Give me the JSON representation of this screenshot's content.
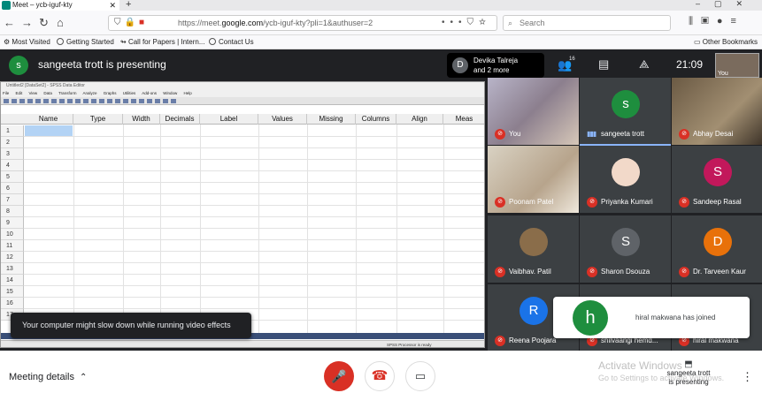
{
  "browser": {
    "tab_title": "Meet – ycb-iguf-kty",
    "url_prefix": "https://meet.",
    "url_domain": "google.com",
    "url_rest": "/ycb-iguf-kty?pli=1&authuser=2",
    "search_placeholder": "Search",
    "bookmarks": [
      "Most Visited",
      "Getting Started",
      "Call for Papers | Intern...",
      "Contact Us"
    ],
    "other_bookmarks": "Other Bookmarks"
  },
  "meet": {
    "presenter_initial": "s",
    "presenting_title": "sangeeta trott is presenting",
    "host_initial": "D",
    "host_name": "Devika Talreja",
    "host_more": "and 2 more",
    "participant_count": "16",
    "time": "21:09",
    "you_label": "You"
  },
  "spss": {
    "title": "Untitled2 [DataSet2] - SPSS Data Editor",
    "menu": "File Edit View Data Transform Analyze Graphs Utilities Add-ons Window Help",
    "columns": [
      "Name",
      "Type",
      "Width",
      "Decimals",
      "Label",
      "Values",
      "Missing",
      "Columns",
      "Align",
      "Meas"
    ],
    "rows": [
      "1",
      "2",
      "3",
      "4",
      "5",
      "6",
      "7",
      "8",
      "9",
      "10",
      "11",
      "12",
      "13",
      "14",
      "15",
      "16",
      "17"
    ],
    "status": "SPSS Processor is ready"
  },
  "toast": "Your computer might slow down while running video effects",
  "tiles": [
    {
      "name": "You",
      "initial": "",
      "color": "#5f6368",
      "muted": true,
      "photo": true
    },
    {
      "name": "sangeeta trott",
      "initial": "s",
      "color": "#1e8e3e",
      "muted": false,
      "photo": false
    },
    {
      "name": "Abhay Desai",
      "initial": "",
      "color": "#5f6368",
      "muted": true,
      "photo": true
    },
    {
      "name": "Poonam Patel",
      "initial": "",
      "color": "#5f6368",
      "muted": true,
      "photo": true
    },
    {
      "name": "Priyanka Kumari",
      "initial": "",
      "color": "#5f6368",
      "muted": true,
      "photo": true
    },
    {
      "name": "Sandeep Rasal",
      "initial": "S",
      "color": "#c2185b",
      "muted": true,
      "photo": false
    },
    {
      "name": "Vaibhav. Patil",
      "initial": "",
      "color": "#5f6368",
      "muted": true,
      "photo": true
    },
    {
      "name": "Sharon Dsouza",
      "initial": "S",
      "color": "#5f6368",
      "muted": true,
      "photo": false
    },
    {
      "name": "Dr. Tarveen Kaur",
      "initial": "D",
      "color": "#e8710a",
      "muted": true,
      "photo": false
    },
    {
      "name": "Reena Poojara",
      "initial": "R",
      "color": "#1a73e8",
      "muted": true,
      "photo": false
    },
    {
      "name": "shilvaangi hemd...",
      "initial": "",
      "color": "#5f6368",
      "muted": true,
      "photo": false
    },
    {
      "name": "hiral makwana",
      "initial": "",
      "color": "#5f6368",
      "muted": true,
      "photo": false
    }
  ],
  "notification": {
    "initial": "h",
    "text": "hiral makwana has joined"
  },
  "bottom": {
    "meeting_details": "Meeting details",
    "activate_title": "Activate Windows",
    "activate_sub": "Go to Settings to activate Windows.",
    "present_line1": "sangeeta trott",
    "present_line2": "is presenting"
  },
  "colors": {
    "meet_bg": "#202124",
    "mute_red": "#d93025",
    "presenter_green": "#1e8e3e"
  },
  "icons": [
    "back-icon",
    "forward-icon",
    "refresh-icon",
    "home-icon",
    "shield-icon",
    "lock-icon",
    "camera-blocked-icon",
    "search-icon",
    "library-icon",
    "sidebar-icon",
    "account-icon",
    "menu-icon",
    "people-icon",
    "chat-icon",
    "activities-icon",
    "mic-off-icon",
    "hangup-icon",
    "camera-icon",
    "present-icon",
    "more-vert-icon"
  ]
}
